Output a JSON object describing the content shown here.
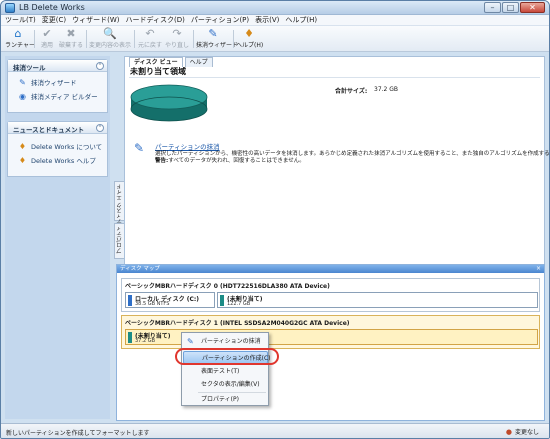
{
  "window": {
    "title": "LB Delete Works"
  },
  "menu": [
    "ツール(T)",
    "変更(C)",
    "ウィザード(W)",
    "ハードディスク(D)",
    "パーティション(P)",
    "表示(V)",
    "ヘルプ(H)"
  ],
  "toolbar": {
    "launcher": "ランチャー",
    "apply": "適用",
    "discard": "破棄する",
    "show_changes": "変更内容の表示",
    "undo": "元に戻す",
    "redo": "やり直し",
    "wipe_wizard": "抹消ウィザード",
    "help": "ヘルプ(H)"
  },
  "sidebar": {
    "wipe_tools": {
      "header": "抹消ツール",
      "items": [
        "抹消ウィザード",
        "抹消メディア ビルダー"
      ]
    },
    "news": {
      "header": "ニュースとドキュメント",
      "items": [
        "Delete Works について",
        "Delete Works ヘルプ"
      ]
    }
  },
  "vtabs": [
    "ディスク エイド",
    "プロパティ"
  ],
  "main": {
    "tabs": [
      "ディスク ビュー",
      "ヘルプ"
    ],
    "title": "未割り当て領域",
    "total_size_label": "合計サイズ:",
    "total_size_value": "37.2 GB",
    "wipe_link": "パーティションの抹消",
    "wipe_desc": "選択したパーティションから、機密性の高いデータを抹消します。あらかじめ定義された抹消アルゴリズムを使用すること、また独自のアルゴリズムを作成することもできます。",
    "warning_label": "警告:",
    "warning_text": "すべてのデータが失われ、回復することはできません。"
  },
  "diskmap": {
    "header": "ディスク マップ",
    "disk0": {
      "label": "ベーシックMBRハードディスク 0 (HDT722516DLA380 ATA Device)",
      "partitions": [
        {
          "name": "ローカル ディスク (C:)",
          "info": "38.5 GB NTFS"
        },
        {
          "name": "(未割り当て)",
          "info": "122.7 GB"
        }
      ]
    },
    "disk1": {
      "label": "ベーシックMBRハードディスク 1 (INTEL SSDSA2M040G2GC ATA Device)",
      "partitions": [
        {
          "name": "(未割り当て)",
          "info": "37.2 GB"
        }
      ]
    }
  },
  "context_menu": {
    "items": [
      "パーティションの抹消",
      "パーティションの作成(C)",
      "表面テスト(T)",
      "セクタの表示/編集(V)",
      "プロパティ(P)"
    ]
  },
  "status": {
    "message": "新しいパーティションを作成してフォーマットします",
    "changes": "変更なし"
  },
  "colors": {
    "accent": "#4a86cf",
    "disk_teal": "#1d8c86",
    "highlight_ring": "#e0362e"
  }
}
